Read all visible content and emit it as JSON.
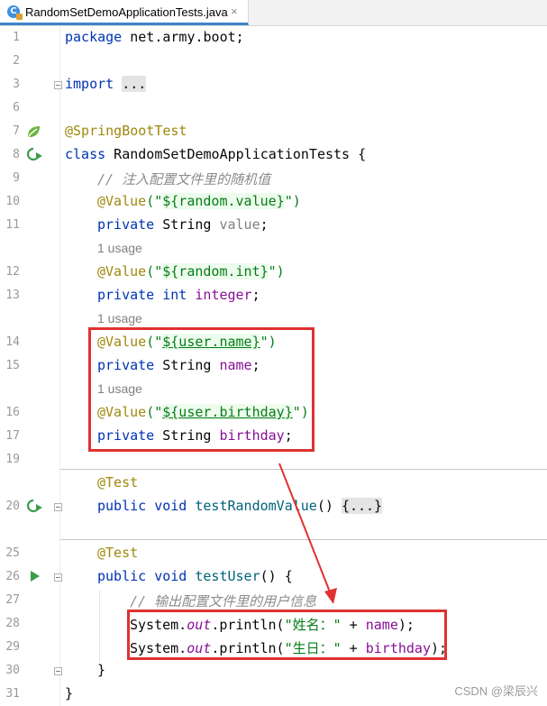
{
  "tab": {
    "filename": "RandomSetDemoApplicationTests.java",
    "close": "×",
    "icon": "java-class-icon"
  },
  "line_numbers": [
    "1",
    "2",
    "3",
    "6",
    "7",
    "8",
    "9",
    "10",
    "11",
    "12",
    "13",
    "14",
    "15",
    "16",
    "17",
    "19",
    "20",
    "25",
    "26",
    "27",
    "28",
    "29",
    "30",
    "31"
  ],
  "code": {
    "pkg_kw": "package",
    "pkg_name": " net.army.boot;",
    "import_kw": "import",
    "import_fold": "...",
    "spring_boot_test": "@SpringBootTest",
    "class_kw": "class",
    "class_name": " RandomSetDemoApplicationTests {",
    "comment1": "// 注入配置文件里的随机值",
    "value_ann": "@Value",
    "open_paren_q": "(\"",
    "close_q_paren": "\")",
    "expr_random_value": "${random.value}",
    "private_kw": "private",
    "string_type": " String ",
    "int_type": " int ",
    "field_value": "value",
    "field_integer": "integer",
    "expr_random_int": "${random.int}",
    "expr_user_name": "${user.name}",
    "field_name": "name",
    "expr_user_birthday": "${user.birthday}",
    "field_birthday": "birthday",
    "semicolon": ";",
    "test_ann": "@Test",
    "public_kw": "public",
    "void_kw": " void ",
    "method1": "testRandomValue",
    "method1_tail": "() ",
    "method1_fold": "{...}",
    "method2": "testUser",
    "method2_tail": "() {",
    "comment2": "// 输出配置文件里的用户信息",
    "sys": "System.",
    "out": "out",
    "println_open": ".println(",
    "str_name": "\"姓名：\"",
    "str_birthday": "\"生日：\"",
    "plus": " + ",
    "close_paren_semi": ");",
    "close_brace_inner": "}",
    "close_brace_outer": "}"
  },
  "usage_hint": "1 usage",
  "gutter_icons": {
    "line7": "spring-bean-icon",
    "line8": "run-rerun-icon",
    "line20": "run-rerun-icon",
    "line26": "run-icon"
  },
  "watermark": "CSDN @梁辰兴",
  "colors": {
    "highlight_box": "#e03131",
    "arrow": "#e03131",
    "keyword": "#0033b3",
    "annotation": "#9e880d",
    "string": "#067d17",
    "field": "#871094"
  }
}
